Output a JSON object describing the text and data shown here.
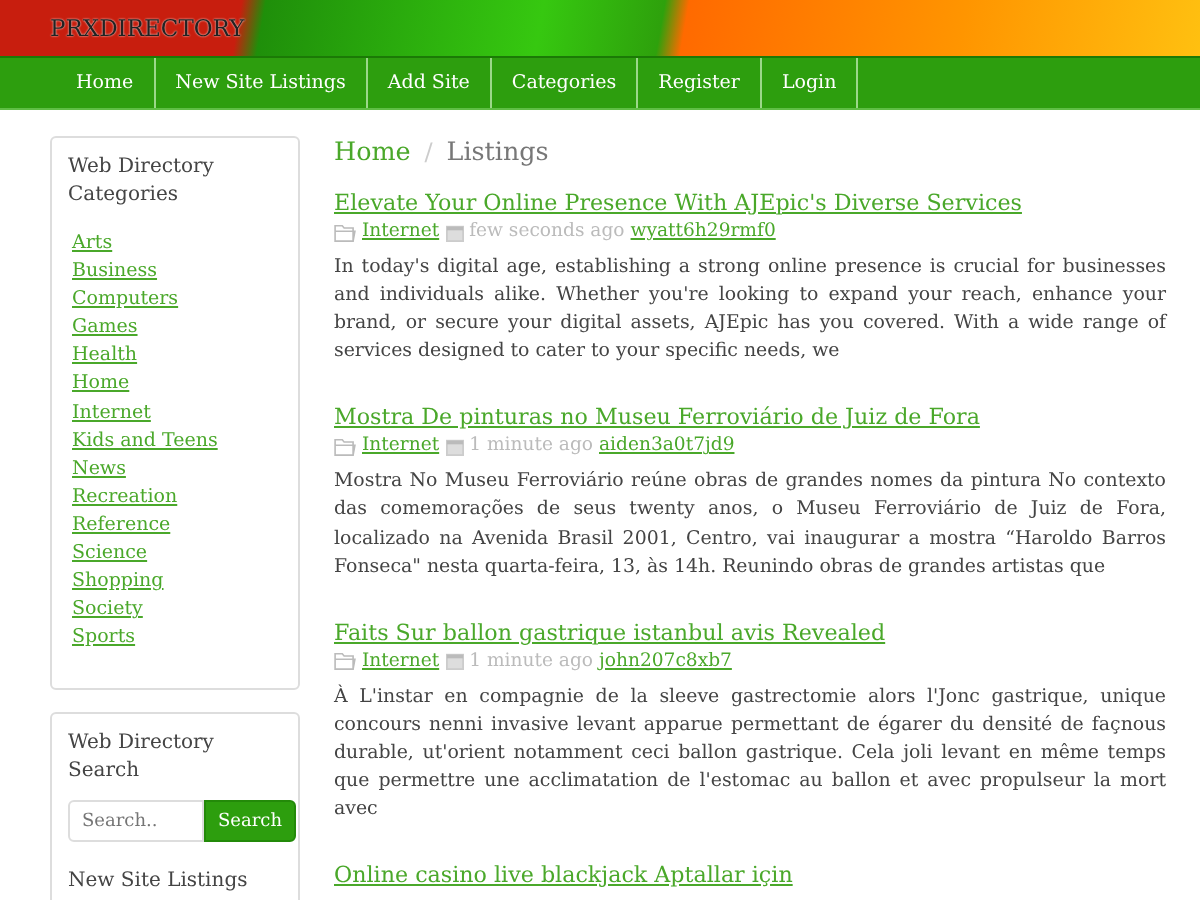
{
  "header": {
    "site_name": "PRXDIRECTORY"
  },
  "nav": [
    "Home",
    "New Site Listings",
    "Add Site",
    "Categories",
    "Register",
    "Login"
  ],
  "sidebar": {
    "categories_title": "Web Directory Categories",
    "categories": [
      "Arts",
      "Business",
      "Computers",
      "Games",
      "Health",
      "Home",
      "Internet",
      "Kids and Teens",
      "News",
      "Recreation",
      "Reference",
      "Science",
      "Shopping",
      "Society",
      "Sports"
    ],
    "search_title": "Web Directory Search",
    "search": {
      "placeholder": "Search..",
      "button": "Search"
    },
    "new_listings_title": "New Site Listings"
  },
  "breadcrumb": {
    "home": "Home",
    "separator": "/",
    "current": "Listings"
  },
  "listings": [
    {
      "title": "Elevate Your Online Presence With AJEpic's Diverse Services",
      "category": "Internet",
      "time": "few seconds ago",
      "user": "wyatt6h29rmf0",
      "text": "In today's digital age, establishing a strong online presence is crucial for businesses and individuals alike. Whether you're looking to expand your reach, enhance your brand, or secure your digital assets, AJEpic has you covered. With a wide range of services designed to cater to your specific needs, we"
    },
    {
      "title": "Mostra De pinturas no Museu Ferroviário de Juiz de Fora",
      "category": "Internet",
      "time": "1 minute ago",
      "user": "aiden3a0t7jd9",
      "text": "Mostra No Museu Ferroviário reúne obras de grandes nomes da pintura No contexto das comemorações de seus twenty anos, o Museu Ferroviário de Juiz de Fora, localizado na Avenida Brasil 2001, Centro, vai inaugurar a mostra “Haroldo Barros Fonseca\" nesta quarta-feira, 13, às 14h. Reunindo obras de grandes artistas que"
    },
    {
      "title": "Faits Sur ballon gastrique istanbul avis Revealed",
      "category": "Internet",
      "time": "1 minute ago",
      "user": "john207c8xb7",
      "text": "À L'instar en compagnie de la sleeve gastrectomie alors l'Jonc gastrique, unique concours nenni invasive levant apparue permettant de égarer du densité de façnous durable, ut'orient notamment ceci ballon gastrique. Cela joli levant en même temps que permettre une acclimatation de l'estomac au ballon et avec propulseur la mort avec"
    },
    {
      "title": "Online casino live blackjack Aptallar için"
    }
  ]
}
